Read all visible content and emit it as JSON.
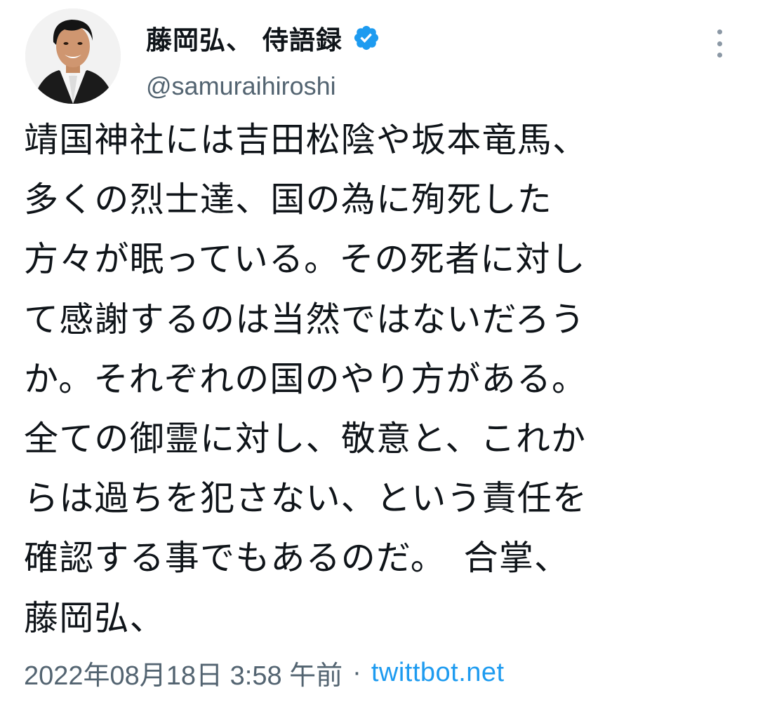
{
  "author": {
    "display_name": "藤岡弘、 侍語録",
    "handle": "@samuraihiroshi",
    "verified": true
  },
  "tweet": {
    "lines": [
      "靖国神社には吉田松陰や坂本竜馬、",
      "多くの烈士達、国の為に殉死した",
      "方々が眠っている。その死者に対し",
      "て感謝するのは当然ではないだろう",
      "か。それぞれの国のやり方がある。",
      "全ての御霊に対し、敬意と、これか",
      "らは過ちを犯さない、という責任を",
      "確認する事でもあるのだ。　合掌、",
      "藤岡弘、"
    ]
  },
  "meta": {
    "timestamp": "2022年08月18日 3:58 午前",
    "separator": "·",
    "source": "twittbot.net"
  },
  "icons": {
    "verified": "verified-badge-icon",
    "more": "more-options-icon"
  },
  "colors": {
    "accent": "#1d9bf0",
    "secondary_text": "#536471",
    "primary_text": "#0f1419"
  }
}
